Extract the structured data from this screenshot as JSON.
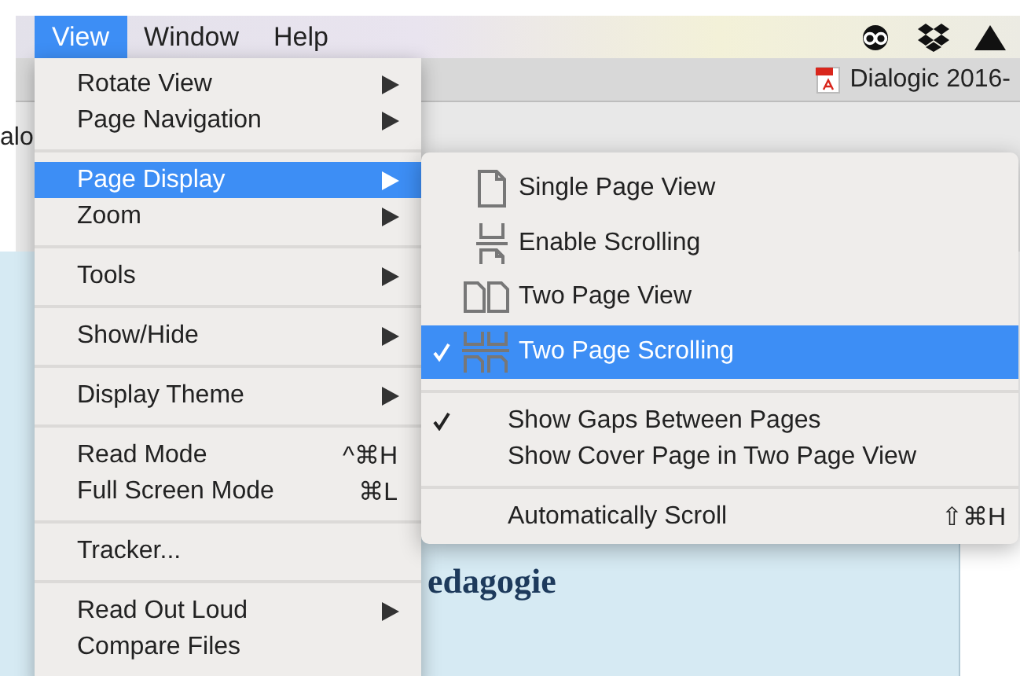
{
  "menubar": {
    "items": [
      {
        "label": "View",
        "selected": true
      },
      {
        "label": "Window",
        "selected": false
      },
      {
        "label": "Help",
        "selected": false
      }
    ]
  },
  "tab": {
    "title": "Dialogic 2016-"
  },
  "sidebar_fragment": "alo",
  "document": {
    "right_lines": [
      "edagogie"
    ]
  },
  "menu": {
    "items": [
      {
        "kind": "item",
        "label": "Rotate View",
        "has_submenu": true,
        "selected": false
      },
      {
        "kind": "item",
        "label": "Page Navigation",
        "has_submenu": true,
        "selected": false
      },
      {
        "kind": "separator"
      },
      {
        "kind": "item",
        "label": "Page Display",
        "has_submenu": true,
        "selected": true
      },
      {
        "kind": "item",
        "label": "Zoom",
        "has_submenu": true,
        "selected": false
      },
      {
        "kind": "separator"
      },
      {
        "kind": "item",
        "label": "Tools",
        "has_submenu": true,
        "selected": false
      },
      {
        "kind": "separator"
      },
      {
        "kind": "item",
        "label": "Show/Hide",
        "has_submenu": true,
        "selected": false
      },
      {
        "kind": "separator"
      },
      {
        "kind": "item",
        "label": "Display Theme",
        "has_submenu": true,
        "selected": false
      },
      {
        "kind": "separator"
      },
      {
        "kind": "item",
        "label": "Read Mode",
        "shortcut": "^⌘H",
        "has_submenu": false,
        "selected": false
      },
      {
        "kind": "item",
        "label": "Full Screen Mode",
        "shortcut": "⌘L",
        "has_submenu": false,
        "selected": false
      },
      {
        "kind": "separator"
      },
      {
        "kind": "item",
        "label": "Tracker...",
        "has_submenu": false,
        "selected": false
      },
      {
        "kind": "separator"
      },
      {
        "kind": "item",
        "label": "Read Out Loud",
        "has_submenu": true,
        "selected": false
      },
      {
        "kind": "item",
        "label": "Compare Files",
        "has_submenu": false,
        "selected": false
      }
    ]
  },
  "submenu": {
    "items": [
      {
        "kind": "single-page",
        "label": "Single Page View",
        "checked": false,
        "selected": false
      },
      {
        "kind": "scrolling",
        "label": "Enable Scrolling",
        "checked": false,
        "selected": false
      },
      {
        "kind": "two-page",
        "label": "Two Page View",
        "checked": false,
        "selected": false
      },
      {
        "kind": "two-page-scrolling",
        "label": "Two Page Scrolling",
        "checked": true,
        "selected": true
      },
      {
        "kind": "separator"
      },
      {
        "kind": "option",
        "label": "Show Gaps Between Pages",
        "checked": true,
        "selected": false
      },
      {
        "kind": "option",
        "label": "Show Cover Page in Two Page View",
        "checked": false,
        "selected": false
      },
      {
        "kind": "separator"
      },
      {
        "kind": "option",
        "label": "Automatically Scroll",
        "shortcut": "⇧⌘H",
        "checked": false,
        "selected": false
      }
    ]
  }
}
